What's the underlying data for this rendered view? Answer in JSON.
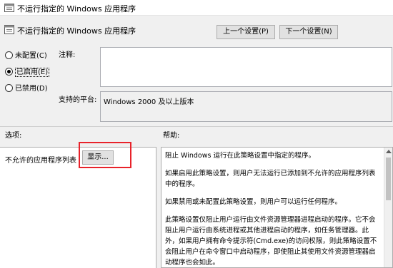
{
  "window": {
    "title": "不运行指定的 Windows 应用程序"
  },
  "header": {
    "policy_name": "不运行指定的 Windows 应用程序"
  },
  "nav": {
    "prev_label": "上一个设置(P)",
    "next_label": "下一个设置(N)"
  },
  "state": {
    "options": [
      {
        "label": "未配置(C)",
        "checked": false
      },
      {
        "label": "已启用(E)",
        "checked": true
      },
      {
        "label": "已禁用(D)",
        "checked": false
      }
    ]
  },
  "comment": {
    "label": "注释:",
    "value": ""
  },
  "platform": {
    "label": "支持的平台:",
    "value": "Windows 2000 及以上版本"
  },
  "options_section": {
    "label": "选项:",
    "list_label": "不允许的应用程序列表",
    "show_button": "显示..."
  },
  "help_section": {
    "label": "帮助:",
    "paragraphs": [
      "阻止 Windows 运行在此策略设置中指定的程序。",
      "如果启用此策略设置，则用户无法运行已添加到不允许的应用程序列表中的程序。",
      "如果禁用或未配置此策略设置，则用户可以运行任何程序。",
      "此策略设置仅阻止用户运行由文件资源管理器进程启动的程序。它不会阻止用户运行由系统进程或其他进程启动的程序，如任务管理器。此外，如果用户拥有命令提示符(Cmd.exe)的访问权限，则此策略设置不会阻止用户在命令窗口中启动程序，即使阻止其使用文件资源管理器启动程序也会如此。"
    ]
  },
  "colors": {
    "highlight": "#e8222a",
    "panel_bg": "#f0f0f0"
  }
}
